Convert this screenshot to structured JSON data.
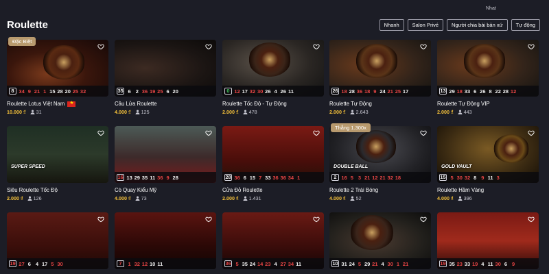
{
  "top_note": "Nhat",
  "page_title": "Roulette",
  "filters": [
    "Nhanh",
    "Salon Privé",
    "Người chia bài bản xứ",
    "Tự động"
  ],
  "colors": {
    "accent": "#f5c13a",
    "background": "#1c1d26",
    "badge": "#b89a6e",
    "red_number": "#e84545",
    "green_number": "#3ec55a"
  },
  "cards": [
    {
      "title": "Roulette Lotus Việt Nam",
      "badge": "Đặc Biệt",
      "flag": "vn-flag",
      "bet": "10.000 ₫",
      "players": "31",
      "numbers": [
        {
          "n": "8",
          "c": "black"
        },
        {
          "n": "34",
          "c": "red"
        },
        {
          "n": "9",
          "c": "red"
        },
        {
          "n": "21",
          "c": "red"
        },
        {
          "n": "1",
          "c": "red"
        },
        {
          "n": "15",
          "c": "black"
        },
        {
          "n": "28",
          "c": "black"
        },
        {
          "n": "20",
          "c": "black"
        },
        {
          "n": "25",
          "c": "red"
        },
        {
          "n": "32",
          "c": "red"
        }
      ]
    },
    {
      "title": "Cầu Lửa Roulette",
      "bet": "4.000 ₫",
      "players": "125",
      "numbers": [
        {
          "n": "35",
          "c": "black"
        },
        {
          "n": "6",
          "c": "black"
        },
        {
          "n": "2",
          "c": "black"
        },
        {
          "n": "36",
          "c": "red"
        },
        {
          "n": "19",
          "c": "red"
        },
        {
          "n": "25",
          "c": "red"
        },
        {
          "n": "6",
          "c": "black"
        },
        {
          "n": "20",
          "c": "black"
        }
      ]
    },
    {
      "title": "Roulette Tốc Độ - Tự Động",
      "bet": "2.000 ₫",
      "players": "478",
      "numbers": [
        {
          "n": "0",
          "c": "green"
        },
        {
          "n": "12",
          "c": "red"
        },
        {
          "n": "17",
          "c": "black"
        },
        {
          "n": "32",
          "c": "red"
        },
        {
          "n": "30",
          "c": "red"
        },
        {
          "n": "26",
          "c": "black"
        },
        {
          "n": "4",
          "c": "black"
        },
        {
          "n": "26",
          "c": "black"
        },
        {
          "n": "11",
          "c": "black"
        }
      ]
    },
    {
      "title": "Roulette Tự Động",
      "bet": "2.000 ₫",
      "players": "2.643",
      "numbers": [
        {
          "n": "26",
          "c": "black"
        },
        {
          "n": "18",
          "c": "red"
        },
        {
          "n": "28",
          "c": "black"
        },
        {
          "n": "36",
          "c": "red"
        },
        {
          "n": "18",
          "c": "red"
        },
        {
          "n": "9",
          "c": "red"
        },
        {
          "n": "24",
          "c": "black"
        },
        {
          "n": "21",
          "c": "red"
        },
        {
          "n": "25",
          "c": "red"
        },
        {
          "n": "17",
          "c": "black"
        }
      ]
    },
    {
      "title": "Roulette Tự Động VIP",
      "bet": "2.000 ₫",
      "players": "443",
      "numbers": [
        {
          "n": "13",
          "c": "black"
        },
        {
          "n": "29",
          "c": "black"
        },
        {
          "n": "18",
          "c": "red"
        },
        {
          "n": "33",
          "c": "black"
        },
        {
          "n": "6",
          "c": "black"
        },
        {
          "n": "26",
          "c": "black"
        },
        {
          "n": "8",
          "c": "black"
        },
        {
          "n": "22",
          "c": "black"
        },
        {
          "n": "28",
          "c": "black"
        },
        {
          "n": "12",
          "c": "red"
        }
      ]
    },
    {
      "title": "Siêu Roulette Tốc Độ",
      "bet": "2.000 ₫",
      "players": "126",
      "overlay_text": "SUPER SPEED",
      "numbers": []
    },
    {
      "title": "Cò Quay Kiểu Mỹ",
      "bet": "4.000 ₫",
      "players": "73",
      "numbers": [
        {
          "n": "16",
          "c": "red"
        },
        {
          "n": "13",
          "c": "black"
        },
        {
          "n": "29",
          "c": "black"
        },
        {
          "n": "35",
          "c": "black"
        },
        {
          "n": "11",
          "c": "black"
        },
        {
          "n": "36",
          "c": "red"
        },
        {
          "n": "9",
          "c": "red"
        },
        {
          "n": "28",
          "c": "black"
        }
      ]
    },
    {
      "title": "Cửa Đỏ Roulette",
      "bet": "2.000 ₫",
      "players": "1.431",
      "numbers": [
        {
          "n": "28",
          "c": "black"
        },
        {
          "n": "36",
          "c": "red"
        },
        {
          "n": "6",
          "c": "black"
        },
        {
          "n": "15",
          "c": "black"
        },
        {
          "n": "7",
          "c": "red"
        },
        {
          "n": "33",
          "c": "black"
        },
        {
          "n": "36",
          "c": "red"
        },
        {
          "n": "36",
          "c": "red"
        },
        {
          "n": "34",
          "c": "red"
        },
        {
          "n": "1",
          "c": "red"
        }
      ]
    },
    {
      "title": "Roulette 2 Trái Bóng",
      "badge": "Thắng 1.300x",
      "bet": "4.000 ₫",
      "players": "52",
      "overlay_text": "DOUBLE BALL",
      "numbers": [
        {
          "n": "2",
          "c": "black"
        },
        {
          "n": "16",
          "c": "red"
        },
        {
          "n": "5",
          "c": "red"
        },
        {
          "n": "3",
          "c": "red"
        },
        {
          "n": "21",
          "c": "red"
        },
        {
          "n": "12",
          "c": "red"
        },
        {
          "n": "21",
          "c": "red"
        },
        {
          "n": "32",
          "c": "red"
        },
        {
          "n": "18",
          "c": "red"
        }
      ]
    },
    {
      "title": "Roulette Hầm Vàng",
      "bet": "4.000 ₫",
      "players": "396",
      "overlay_text": "GOLD VAULT",
      "numbers": [
        {
          "n": "15",
          "c": "black"
        },
        {
          "n": "5",
          "c": "red"
        },
        {
          "n": "30",
          "c": "red"
        },
        {
          "n": "32",
          "c": "red"
        },
        {
          "n": "8",
          "c": "black"
        },
        {
          "n": "9",
          "c": "red"
        },
        {
          "n": "11",
          "c": "black"
        },
        {
          "n": "3",
          "c": "red"
        }
      ]
    },
    {
      "title": "",
      "bet": "",
      "players": "",
      "numbers": [
        {
          "n": "19",
          "c": "red"
        },
        {
          "n": "27",
          "c": "red"
        },
        {
          "n": "6",
          "c": "black"
        },
        {
          "n": "4",
          "c": "black"
        },
        {
          "n": "17",
          "c": "black"
        },
        {
          "n": "5",
          "c": "red"
        },
        {
          "n": "30",
          "c": "red"
        }
      ]
    },
    {
      "title": "",
      "bet": "",
      "players": "",
      "numbers": [
        {
          "n": "7",
          "c": "red"
        },
        {
          "n": "1",
          "c": "red"
        },
        {
          "n": "32",
          "c": "red"
        },
        {
          "n": "12",
          "c": "red"
        },
        {
          "n": "10",
          "c": "black"
        },
        {
          "n": "11",
          "c": "black"
        }
      ]
    },
    {
      "title": "",
      "bet": "",
      "players": "",
      "numbers": [
        {
          "n": "36",
          "c": "red"
        },
        {
          "n": "5",
          "c": "red"
        },
        {
          "n": "35",
          "c": "black"
        },
        {
          "n": "24",
          "c": "black"
        },
        {
          "n": "14",
          "c": "red"
        },
        {
          "n": "23",
          "c": "red"
        },
        {
          "n": "4",
          "c": "black"
        },
        {
          "n": "27",
          "c": "red"
        },
        {
          "n": "34",
          "c": "red"
        },
        {
          "n": "11",
          "c": "black"
        }
      ]
    },
    {
      "title": "",
      "bet": "",
      "players": "",
      "numbers": [
        {
          "n": "10",
          "c": "black"
        },
        {
          "n": "31",
          "c": "black"
        },
        {
          "n": "24",
          "c": "black"
        },
        {
          "n": "5",
          "c": "red"
        },
        {
          "n": "29",
          "c": "black"
        },
        {
          "n": "21",
          "c": "red"
        },
        {
          "n": "4",
          "c": "black"
        },
        {
          "n": "30",
          "c": "red"
        },
        {
          "n": "1",
          "c": "red"
        },
        {
          "n": "21",
          "c": "red"
        }
      ]
    },
    {
      "title": "",
      "bet": "",
      "players": "",
      "numbers": [
        {
          "n": "19",
          "c": "red"
        },
        {
          "n": "35",
          "c": "black"
        },
        {
          "n": "23",
          "c": "red"
        },
        {
          "n": "33",
          "c": "black"
        },
        {
          "n": "19",
          "c": "red"
        },
        {
          "n": "4",
          "c": "black"
        },
        {
          "n": "11",
          "c": "black"
        },
        {
          "n": "30",
          "c": "red"
        },
        {
          "n": "6",
          "c": "black"
        },
        {
          "n": "9",
          "c": "red"
        }
      ]
    }
  ]
}
